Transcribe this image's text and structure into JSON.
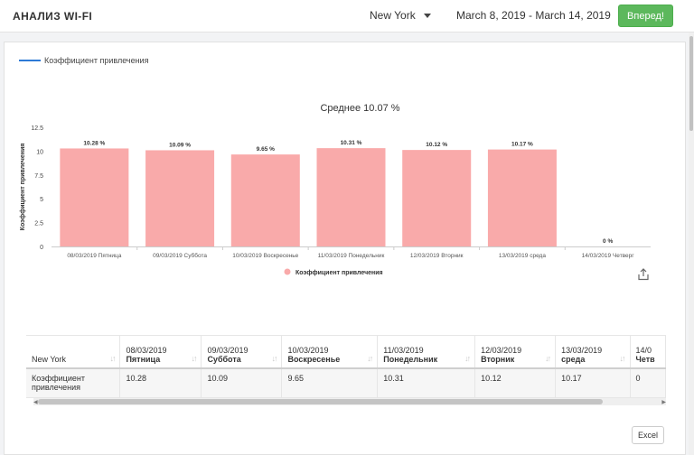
{
  "header": {
    "title": "АНАЛИЗ WI-FI",
    "city": "New York",
    "date_range": "March 8, 2019 - March 14, 2019",
    "go_label": "Вперед!"
  },
  "colors": {
    "bar": "#f9aaaa",
    "line_legend": "#2d7ad6",
    "go_button": "#5cb85c"
  },
  "top_legend": "Коэффициент привлечения",
  "chart_data": {
    "type": "bar",
    "title": "Среднее 10.07 %",
    "ylabel": "Коэффициент привлечения",
    "xlabel": "",
    "ylim": [
      0,
      12.5
    ],
    "yticks": [
      "0",
      "2.5",
      "5",
      "7.5",
      "10",
      "12.5"
    ],
    "ytick_values": [
      0,
      2.5,
      5,
      7.5,
      10,
      12.5
    ],
    "categories": [
      "08/03/2019 Пятница",
      "09/03/2019 Суббота",
      "10/03/2019 Воскресенье",
      "11/03/2019 Понедельник",
      "12/03/2019 Вторник",
      "13/03/2019 среда",
      "14/03/2019 Четверг"
    ],
    "series": [
      {
        "name": "Коэффициент привлечения",
        "values": [
          10.28,
          10.09,
          9.65,
          10.31,
          10.12,
          10.17,
          0
        ]
      }
    ],
    "data_labels": [
      "10.28 %",
      "10.09 %",
      "9.65 %",
      "10.31 %",
      "10.12 %",
      "10.17 %",
      "0 %"
    ],
    "legend_position": "bottom",
    "grid": false
  },
  "table": {
    "corner": "New York",
    "columns": [
      {
        "date": "08/03/2019",
        "day": "Пятница"
      },
      {
        "date": "09/03/2019",
        "day": "Суббота"
      },
      {
        "date": "10/03/2019",
        "day": "Воскресенье"
      },
      {
        "date": "11/03/2019",
        "day": "Понедельник"
      },
      {
        "date": "12/03/2019",
        "day": "Вторник"
      },
      {
        "date": "13/03/2019",
        "day": "среда"
      },
      {
        "date": "14/0",
        "day": "Четв"
      }
    ],
    "row_label": "Коэффициент привлечения",
    "values": [
      "10.28",
      "10.09",
      "9.65",
      "10.31",
      "10.12",
      "10.17",
      "0"
    ]
  },
  "excel_label": "Excel",
  "icons": {
    "export": "share-export-icon",
    "caret": "caret-down-icon",
    "sort": "sort-arrows-icon"
  }
}
